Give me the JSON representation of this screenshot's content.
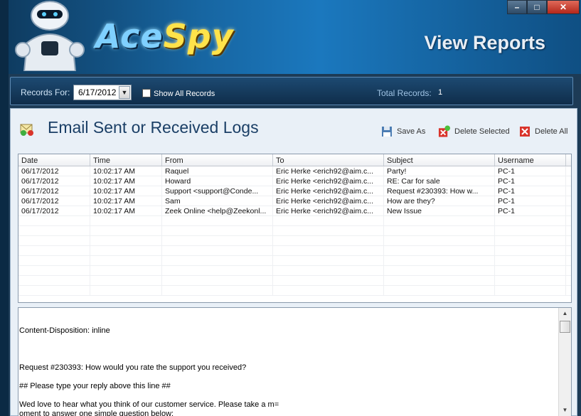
{
  "header": {
    "logo_ace": "Ace",
    "logo_spy": "Spy",
    "view_title": "View Reports",
    "window_buttons": [
      "–",
      "□",
      "✕"
    ]
  },
  "filter": {
    "records_for_label": "Records For:",
    "date_value": "6/17/2012",
    "show_all_label": "Show All Records",
    "show_all_checked": false,
    "total_label": "Total Records:",
    "total_value": "1"
  },
  "panel": {
    "title": "Email Sent or Received Logs",
    "save_as": "Save As",
    "delete_selected": "Delete Selected",
    "delete_all": "Delete All"
  },
  "grid": {
    "columns": [
      "Date",
      "Time",
      "From",
      "To",
      "Subject",
      "Username"
    ],
    "rows": [
      [
        "06/17/2012",
        "10:02:17 AM",
        "Raquel",
        "Eric Herke  <erich92@aim.c...",
        "Party!",
        "PC-1"
      ],
      [
        "06/17/2012",
        "10:02:17 AM",
        "Howard",
        "Eric Herke  <erich92@aim.c...",
        "RE: Car for sale",
        "PC-1"
      ],
      [
        "06/17/2012",
        "10:02:17 AM",
        "Support <support@Conde...",
        "Eric Herke  <erich92@aim.c...",
        "Request #230393: How w...",
        "PC-1"
      ],
      [
        "06/17/2012",
        "10:02:17 AM",
        "Sam",
        "Eric Herke  <erich92@aim.c...",
        "How are they?",
        "PC-1"
      ],
      [
        "06/17/2012",
        "10:02:17 AM",
        "Zeek Online <help@Zeekonl...",
        "Eric Herke  <erich92@aim.c...",
        "New Issue",
        "PC-1"
      ]
    ]
  },
  "message": {
    "lines": [
      "",
      "",
      "Content-Disposition: inline",
      "",
      "",
      "",
      "Request #230393: How would you rate the support you received?",
      "",
      "## Please type your reply above this line ##",
      "",
      "Wed love to hear what you think of our customer service. Please take a m=",
      "oment to answer one simple question below:"
    ]
  },
  "colors": {
    "header_blue": "#1b78be",
    "title_blue": "#1b3f66",
    "panel_bg": "#e9f0f7"
  }
}
